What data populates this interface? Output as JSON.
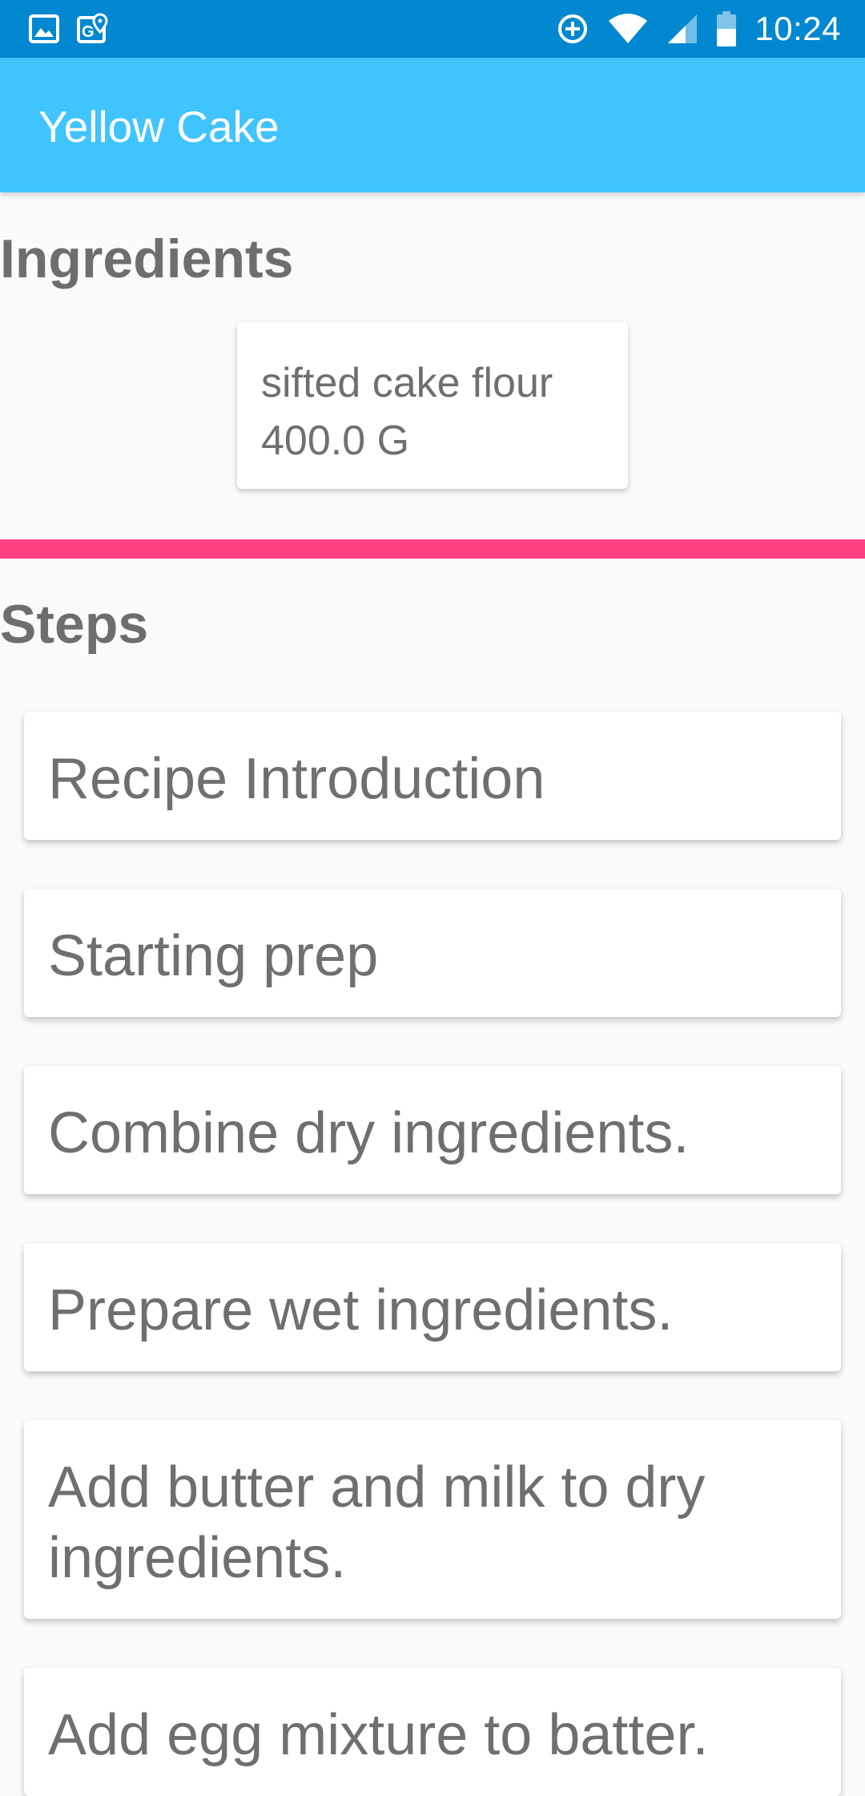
{
  "status_bar": {
    "time": "10:24",
    "left_icons": [
      "image-icon",
      "maps-icon"
    ],
    "right_icons": [
      "data-saver-icon",
      "wifi-icon",
      "signal-icon",
      "battery-icon"
    ]
  },
  "app_bar": {
    "title": "Yellow Cake",
    "color": "#40c4ff"
  },
  "ingredients": {
    "header": "Ingredients",
    "items": [
      {
        "name": "sifted cake flour",
        "quantity": "400.0 G"
      }
    ]
  },
  "divider_color": "#ff4081",
  "steps": {
    "header": "Steps",
    "items": [
      {
        "label": "Recipe Introduction"
      },
      {
        "label": "Starting prep"
      },
      {
        "label": "Combine dry ingredients."
      },
      {
        "label": "Prepare wet ingredients."
      },
      {
        "label": "Add butter and milk to dry ingredients."
      },
      {
        "label": "Add egg mixture to batter."
      }
    ]
  }
}
